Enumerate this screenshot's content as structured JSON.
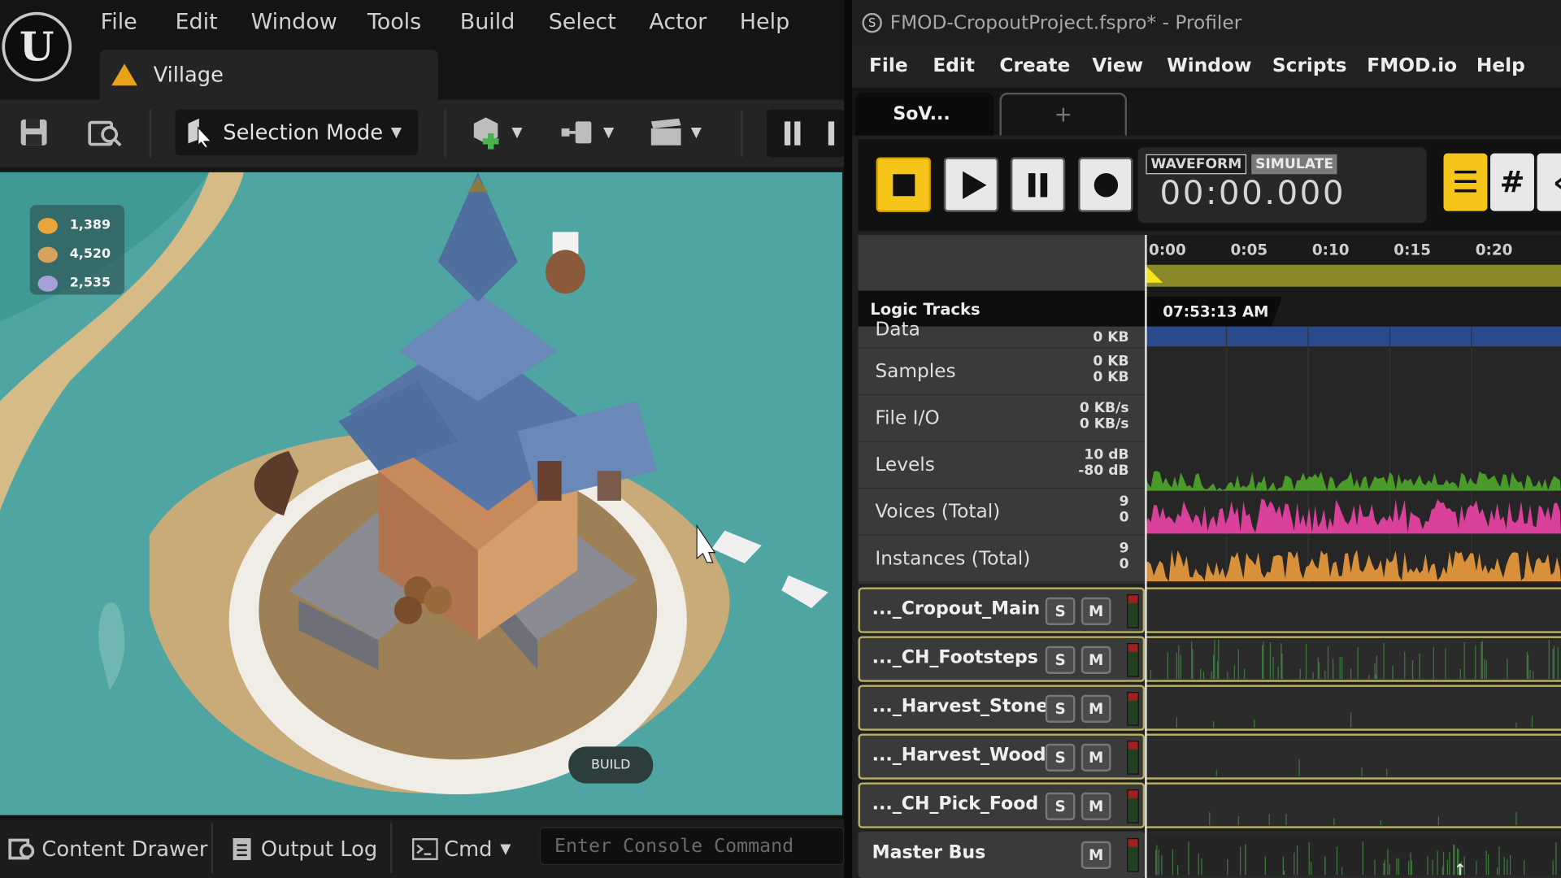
{
  "ue": {
    "logo": "U",
    "menu": [
      "File",
      "Edit",
      "Window",
      "Tools",
      "Build",
      "Select",
      "Actor",
      "Help"
    ],
    "level_tab": "Village",
    "toolbar": {
      "selection_mode": "Selection Mode",
      "icons": [
        "save-icon",
        "browse-icon",
        "add-actor-icon",
        "blueprint-icon",
        "cinematics-icon",
        "pause-icon"
      ]
    },
    "hud": {
      "resources": [
        {
          "icon": "food-icon",
          "value": "1,389",
          "color": "#e9a53a"
        },
        {
          "icon": "wood-icon",
          "value": "4,520",
          "color": "#d8a25a"
        },
        {
          "icon": "stone-icon",
          "value": "2,535",
          "color": "#a7a0d8"
        }
      ],
      "build_label": "BUILD"
    },
    "bottom": {
      "content_drawer": "Content Drawer",
      "output_log": "Output Log",
      "cmd": "Cmd",
      "console_placeholder": "Enter Console Command"
    }
  },
  "fmod": {
    "title": "FMOD-CropoutProject.fspro* - Profiler",
    "menu": [
      "File",
      "Edit",
      "Create",
      "View",
      "Window",
      "Scripts",
      "FMOD.io",
      "Help"
    ],
    "tabs": {
      "active": "SoV...",
      "add": "+"
    },
    "transport": {
      "mode_waveform": "WAVEFORM",
      "mode_simulate": "SIMULATE",
      "time": "00:00.000",
      "loop_icon": "⟷",
      "follow_icon": "➜"
    },
    "ruler_ticks": [
      "0:00",
      "0:05",
      "0:10",
      "0:15",
      "0:20"
    ],
    "logic_tracks_label": "Logic Tracks",
    "clock": "07:53:13 AM",
    "metrics": [
      {
        "name": "Data",
        "v1": "0 KB",
        "v2": ""
      },
      {
        "name": "Samples",
        "v1": "0 KB",
        "v2": "0 KB"
      },
      {
        "name": "File I/O",
        "v1": "0 KB/s",
        "v2": "0 KB/s"
      },
      {
        "name": "Levels",
        "v1": "10 dB",
        "v2": "-80 dB"
      },
      {
        "name": "Voices (Total)",
        "v1": "9",
        "v2": "0"
      },
      {
        "name": "Instances (Total)",
        "v1": "9",
        "v2": "0"
      }
    ],
    "tracks": [
      {
        "name": "..._Cropout_Main",
        "solo": "S",
        "mute": "M"
      },
      {
        "name": "..._CH_Footsteps",
        "solo": "S",
        "mute": "M"
      },
      {
        "name": "..._Harvest_Stone",
        "solo": "S",
        "mute": "M"
      },
      {
        "name": "..._Harvest_Wood",
        "solo": "S",
        "mute": "M"
      },
      {
        "name": "..._CH_Pick_Food",
        "solo": "S",
        "mute": "M"
      }
    ],
    "master": {
      "name": "Master Bus",
      "mute": "M"
    },
    "colors": {
      "accent": "#f5c51a",
      "data_bar": "#2b4a8c",
      "levels": "#4a9a2a",
      "voices": "#d8409a",
      "instances": "#d9903a"
    }
  }
}
